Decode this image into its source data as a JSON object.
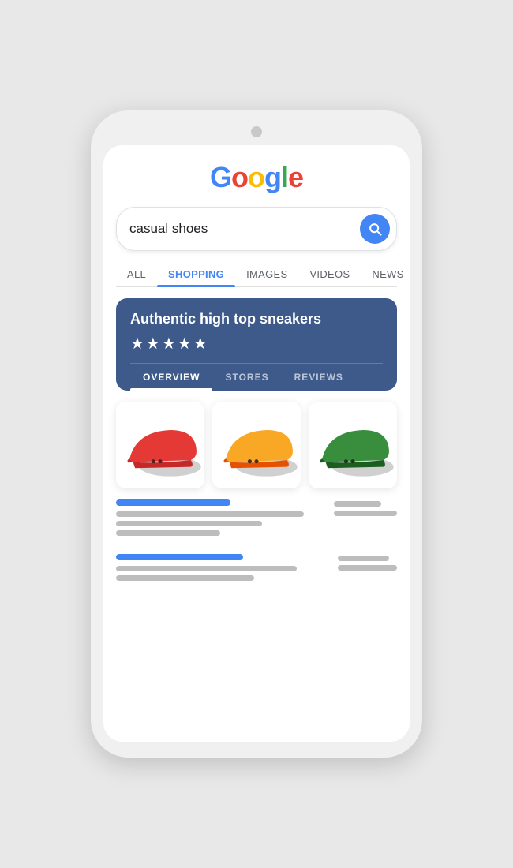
{
  "phone": {
    "background_color": "#f0f0f0"
  },
  "google_logo": {
    "letters": [
      {
        "char": "G",
        "color_class": "g-blue"
      },
      {
        "char": "o",
        "color_class": "g-red"
      },
      {
        "char": "o",
        "color_class": "g-yellow"
      },
      {
        "char": "g",
        "color_class": "g-blue"
      },
      {
        "char": "l",
        "color_class": "g-green"
      },
      {
        "char": "e",
        "color_class": "g-red"
      }
    ]
  },
  "search": {
    "query": "casual shoes",
    "placeholder": "casual shoes",
    "button_aria": "Search"
  },
  "tabs": [
    {
      "label": "ALL",
      "active": false
    },
    {
      "label": "SHOPPING",
      "active": true
    },
    {
      "label": "IMAGES",
      "active": false
    },
    {
      "label": "VIDEOS",
      "active": false
    },
    {
      "label": "NEWS",
      "active": false
    }
  ],
  "product_card": {
    "title": "Authentic high top sneakers",
    "stars": "★★★★★",
    "tabs": [
      {
        "label": "OVERVIEW",
        "active": true
      },
      {
        "label": "STORES",
        "active": false
      },
      {
        "label": "REVIEWS",
        "active": false
      }
    ]
  },
  "shoe_colors": [
    "#E53935",
    "#F9A825",
    "#388E3C"
  ],
  "result_items": [
    {
      "title_width": "55%",
      "lines": [
        "90%",
        "70%",
        "50%"
      ],
      "thumb_lines": [
        "40%",
        "60%"
      ]
    },
    {
      "title_width": "60%",
      "lines": [
        "85%",
        "65%"
      ],
      "thumb_lines": [
        "45%",
        "55%"
      ]
    }
  ]
}
